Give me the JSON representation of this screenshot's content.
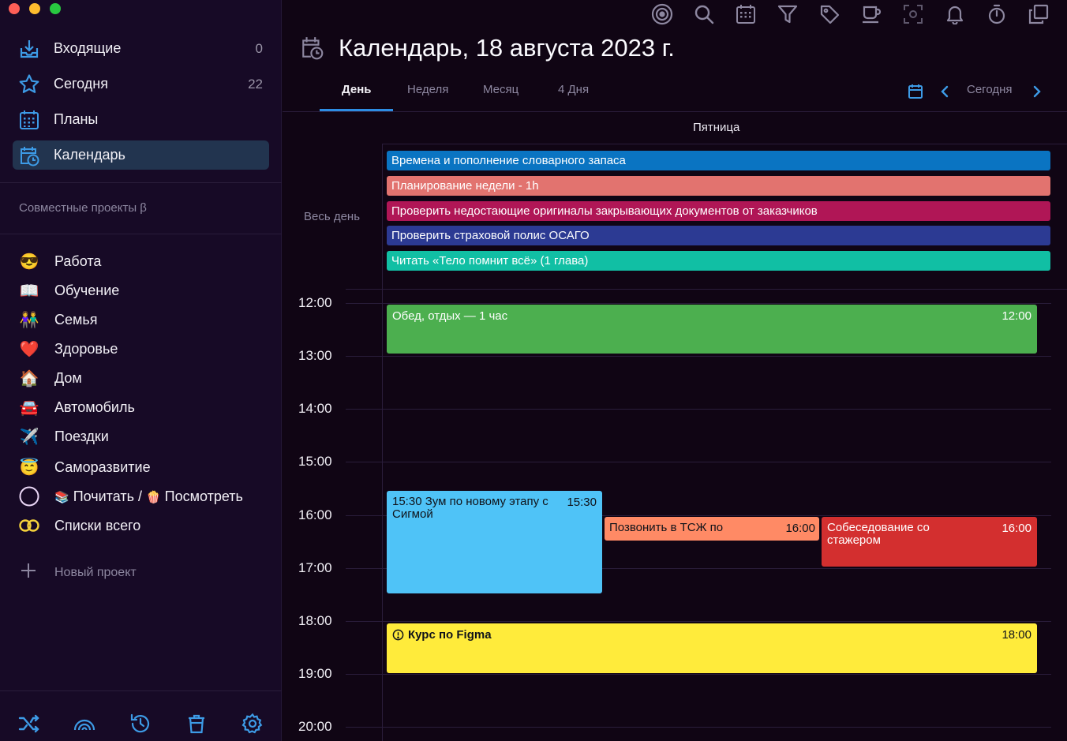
{
  "window": {
    "traffic_colors": [
      "#fe5f57",
      "#febc2e",
      "#28c840"
    ]
  },
  "sidebar": {
    "items": [
      {
        "label": "Входящие",
        "count": "0",
        "icon": "inbox-icon"
      },
      {
        "label": "Сегодня",
        "count": "22",
        "icon": "star-icon"
      },
      {
        "label": "Планы",
        "count": "",
        "icon": "plans-calendar-icon"
      },
      {
        "label": "Календарь",
        "count": "",
        "icon": "calendar-clock-icon",
        "active": true
      }
    ],
    "shared_title": "Совместные проекты β",
    "projects": [
      {
        "emoji": "😎",
        "label": "Работа"
      },
      {
        "emoji": "📖",
        "label": "Обучение"
      },
      {
        "emoji": "👫",
        "label": "Семья"
      },
      {
        "emoji": "❤️",
        "label": "Здоровье"
      },
      {
        "emoji": "🏠",
        "label": "Дом"
      },
      {
        "emoji": "🚘",
        "label": "Автомобиль"
      },
      {
        "emoji": "✈️",
        "label": "Поездки"
      },
      {
        "emoji": "😇",
        "label": "Саморазвитие"
      },
      {
        "emoji": "",
        "label_pre": "📚",
        "label_a": " Почитать / ",
        "label_mid": "🍿",
        "label_b": " Посмотреть"
      },
      {
        "emoji": "",
        "label": "Списки всего"
      }
    ],
    "new_project": "Новый проект",
    "bottom_icons": [
      "shuffle-icon",
      "rainbow-icon",
      "history-icon",
      "trash-icon",
      "settings-icon"
    ]
  },
  "toolbar": {
    "icons": [
      "focus-icon",
      "search-icon",
      "calendar-grid-icon",
      "filter-icon",
      "tag-icon",
      "coffee-icon",
      "scan-icon",
      "bell-icon",
      "timer-icon",
      "copy-icon"
    ]
  },
  "main": {
    "title": "Календарь, 18 августа 2023 г.",
    "tabs": [
      "День",
      "Неделя",
      "Месяц",
      "4 Дня"
    ],
    "today_label": "Сегодня",
    "day_name": "Пятница",
    "allday_label": "Весь день",
    "hours": [
      "12:00",
      "13:00",
      "14:00",
      "15:00",
      "16:00",
      "17:00",
      "18:00",
      "19:00",
      "20:00"
    ]
  },
  "allday_events": [
    {
      "title": "Времена и пополнение словарного запаса",
      "color": "#0a74c2"
    },
    {
      "title": "Планирование недели - 1h",
      "color": "#e2736f"
    },
    {
      "title": "Проверить недостающие оригиналы закрывающих документов от заказчиков",
      "color": "#b01656"
    },
    {
      "title": "Проверить страховой полис ОСАГО",
      "color": "#2c3a93"
    },
    {
      "title": "Читать «Тело помнит всё» (1 глава)",
      "color": "#11bfa4"
    }
  ],
  "events": [
    {
      "title": "Обед, отдых — 1 час",
      "time": "12:00",
      "color": "#4caf4f",
      "text": "#ffffff"
    },
    {
      "title": "15:30 Зум по новому этапу с Сигмой",
      "time": "15:30",
      "color": "#4fc3f7",
      "text": "#10131a"
    },
    {
      "title": "Позвонить в ТСЖ по",
      "time": "16:00",
      "color": "#ff8a65",
      "text": "#10131a"
    },
    {
      "title": "Собеседование со стажером",
      "time": "16:00",
      "color": "#d32f2f",
      "text": "#ffffff"
    },
    {
      "title": "Курс по Figma",
      "time": "18:00",
      "color": "#ffeb3b",
      "text": "#10131a"
    }
  ]
}
